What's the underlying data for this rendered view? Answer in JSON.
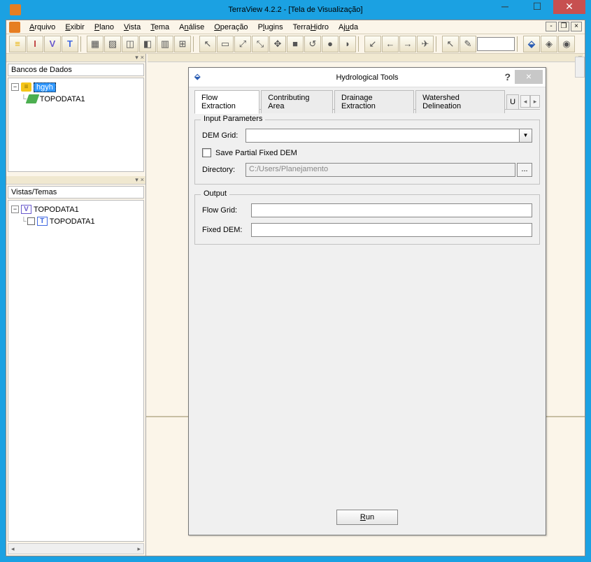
{
  "window": {
    "title": "TerraView 4.2.2 - [Tela de Visualização]"
  },
  "menu": {
    "arquivo": "Arquivo",
    "exibir": "Exibir",
    "plano": "Plano",
    "vista": "Vista",
    "tema": "Tema",
    "analise": "Análise",
    "operacao": "Operação",
    "plugins": "Plugins",
    "terrahidro": "TerraHidro",
    "ajuda": "Ajuda"
  },
  "panes": {
    "databases_title": "Bancos de Dados",
    "views_title": "Vistas/Temas",
    "db_root": "hgyh",
    "db_child": "TOPODATA1",
    "view_root": "TOPODATA1",
    "view_child": "TOPODATA1"
  },
  "dialog": {
    "title": "Hydrological Tools",
    "tabs": {
      "flow": "Flow Extraction",
      "contrib": "Contributing Area",
      "drainage": "Drainage Extraction",
      "watershed": "Watershed Delineation",
      "more": "U"
    },
    "input": {
      "legend": "Input Parameters",
      "dem_label": "DEM Grid:",
      "save_partial": "Save Partial Fixed DEM",
      "directory_label": "Directory:",
      "directory_value": "C:/Users/Planejamento"
    },
    "output": {
      "legend": "Output",
      "flow_label": "Flow Grid:",
      "fixed_label": "Fixed DEM:"
    },
    "run": "Run"
  }
}
